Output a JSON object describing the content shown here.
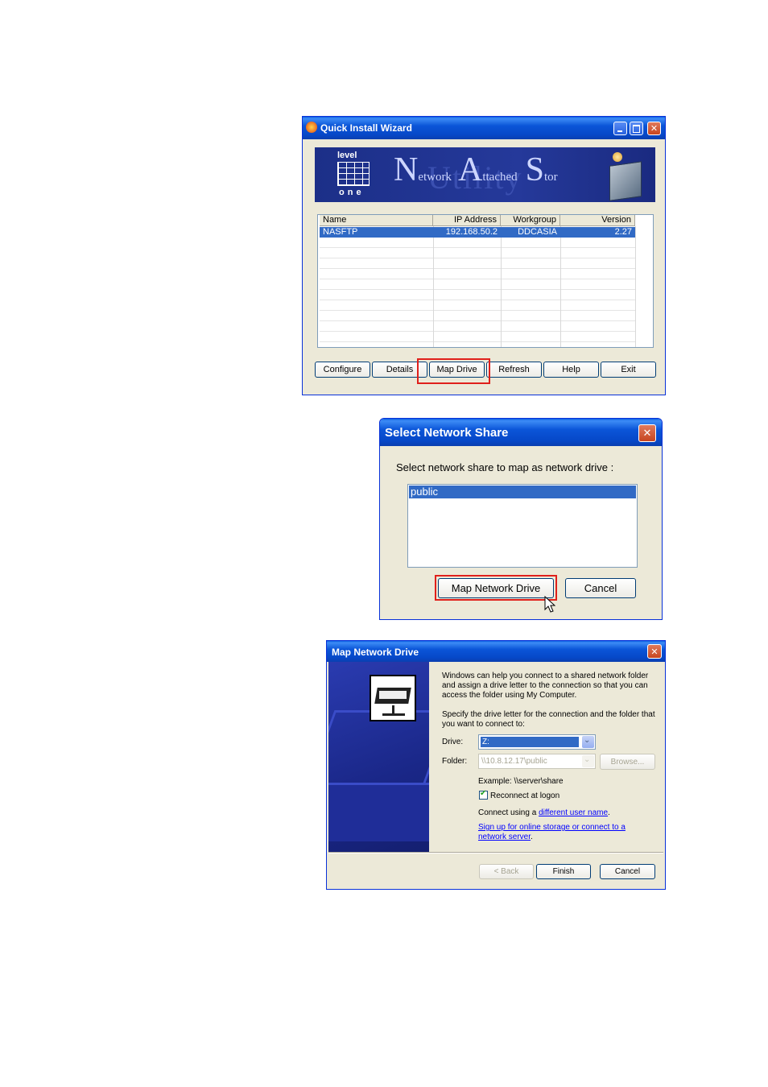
{
  "wizard": {
    "title": "Quick Install Wizard",
    "banner": {
      "logo_top": "level",
      "logo_bottom": "one",
      "text_n": "N",
      "text_network": "etwork",
      "text_a": "A",
      "text_attached": "ttached",
      "text_s": "S",
      "text_storage": "tor",
      "overlay": "Utility"
    },
    "columns": [
      "Name",
      "IP Address",
      "Workgroup",
      "Version"
    ],
    "rows": [
      {
        "name": "NASFTP",
        "ip": "192.168.50.2",
        "workgroup": "DDCASIA",
        "version": "2.27"
      }
    ],
    "buttons": {
      "configure": "Configure",
      "details": "Details",
      "map_drive": "Map Drive",
      "refresh": "Refresh",
      "help": "Help",
      "exit": "Exit"
    }
  },
  "share": {
    "title": "Select Network Share",
    "prompt": "Select network share to map as network drive :",
    "items": [
      "public"
    ],
    "buttons": {
      "map": "Map Network Drive",
      "cancel": "Cancel"
    }
  },
  "mapdrive": {
    "title": "Map Network Drive",
    "intro": "Windows can help you connect to a shared network folder and assign a drive letter to the connection so that you can access the folder using My Computer.",
    "specify": "Specify the drive letter for the connection and the folder that you want to connect to:",
    "drive_label": "Drive:",
    "drive_value": "Z:",
    "folder_label": "Folder:",
    "folder_value": "\\\\10.8.12.17\\public",
    "browse": "Browse...",
    "example": "Example: \\\\server\\share",
    "reconnect": "Reconnect at logon",
    "connect_prefix": "Connect using a ",
    "connect_link": "different user name",
    "connect_suffix": ".",
    "signup_link": "Sign up for online storage or connect to a network server",
    "signup_suffix": ".",
    "buttons": {
      "back": "< Back",
      "finish": "Finish",
      "cancel": "Cancel"
    }
  },
  "colors": {
    "xp_blue": "#0648c8",
    "selection": "#316ac5",
    "highlight_box": "#e0201b",
    "dialog_face": "#ece9d8"
  }
}
